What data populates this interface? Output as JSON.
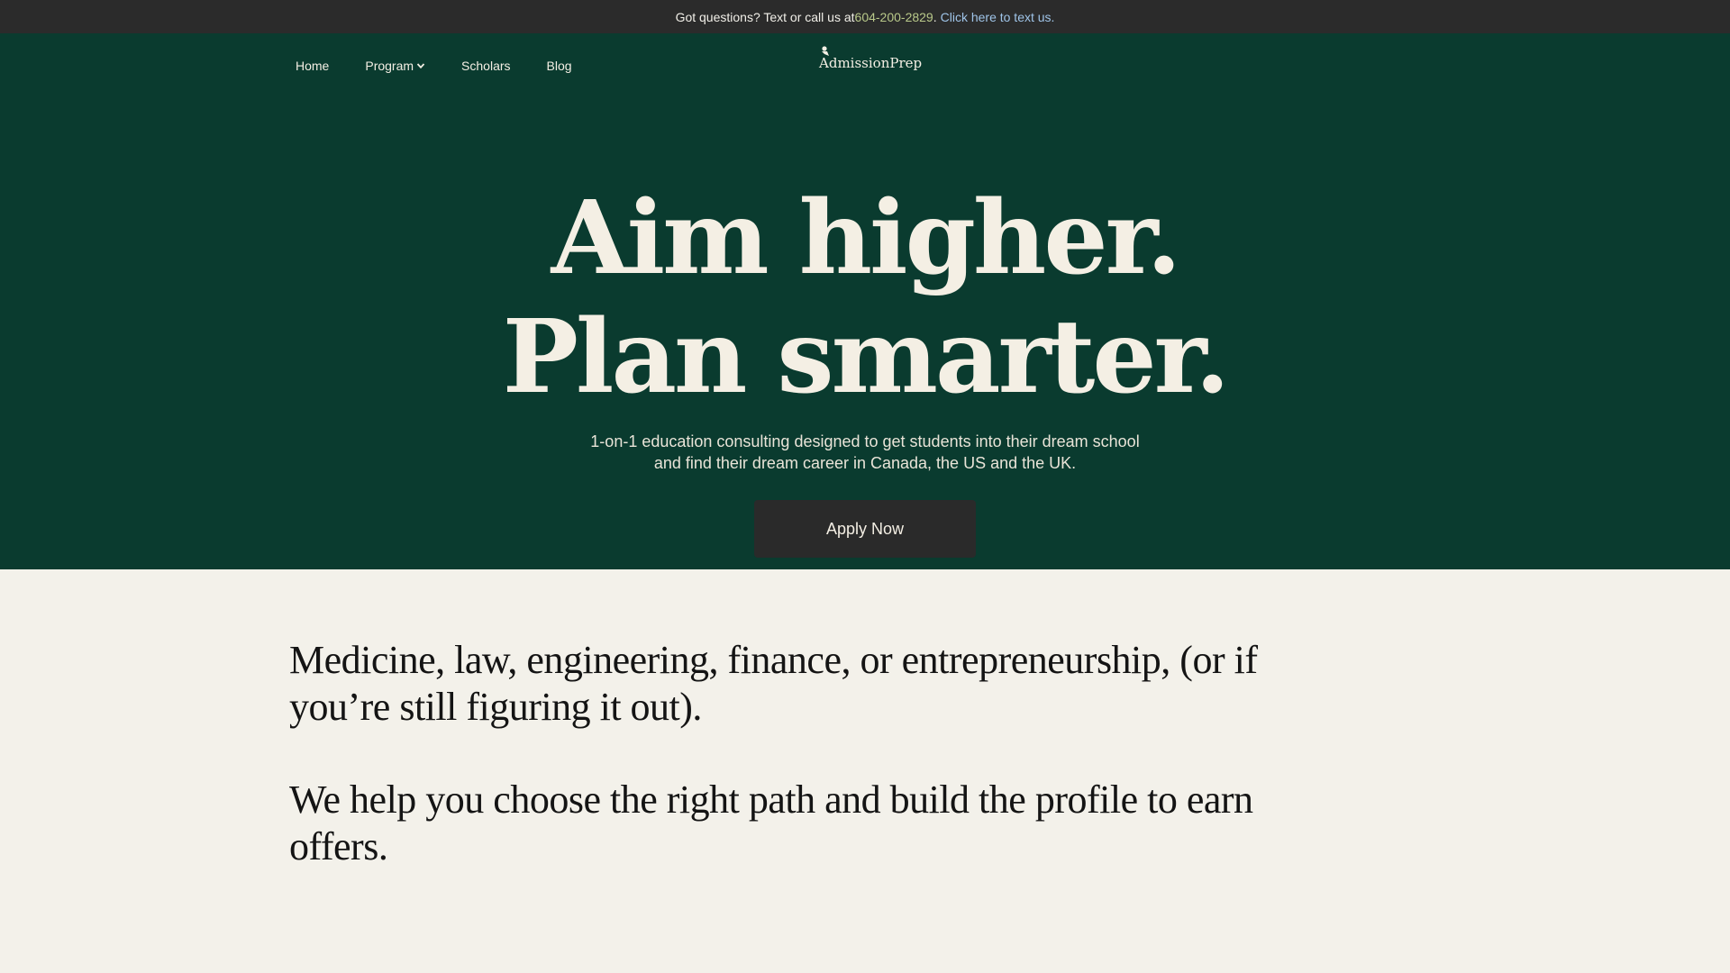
{
  "topbar": {
    "prefix": "Got questions? Text or call us at ",
    "phone": "604-200-2829",
    "separator": ".",
    "text_link": "Click here to text us."
  },
  "nav": {
    "items": [
      {
        "label": "Home"
      },
      {
        "label": "Program"
      },
      {
        "label": "Scholars"
      },
      {
        "label": "Blog"
      }
    ],
    "logo_text": "dmissionPrep",
    "logo_initial": "A"
  },
  "hero": {
    "headline_line1": "Aim higher.",
    "headline_line2": "Plan smarter.",
    "subtitle_line1": "1-on-1 education consulting designed to get students into their dream school",
    "subtitle_line2": "and find their dream career in Canada, the US and the UK.",
    "cta_label": "Apply Now"
  },
  "intro": {
    "paragraph1": "Medicine, law, engineering, finance, or entrepreneurship, (or if you’re still figuring it out).",
    "paragraph2": "We help you choose the right path and build the profile to earn offers."
  },
  "colors": {
    "hero_bg": "#0a3b2f",
    "topbar_bg": "#2b2b2b",
    "page_bg": "#f3f1ea",
    "button_bg": "#2a2a2a",
    "phone_link": "#b9c98a",
    "text_link": "#9fc4e8"
  },
  "icons": {
    "dropdown": "chevron-down-icon",
    "logo": "graduate-logo-icon"
  }
}
